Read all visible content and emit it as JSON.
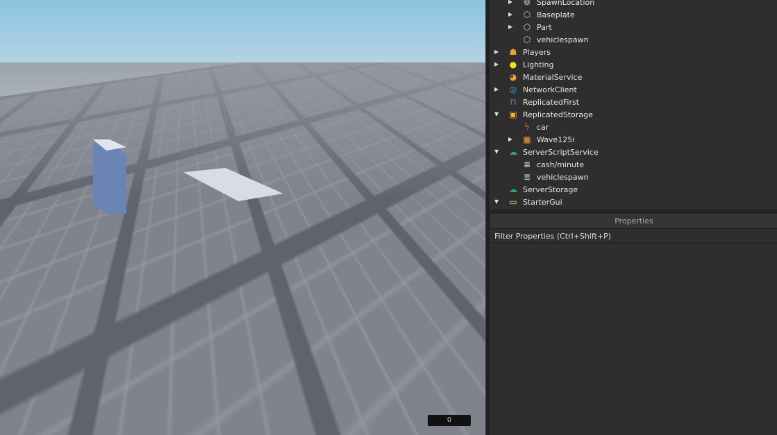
{
  "viewport": {
    "counter": "0"
  },
  "explorer": {
    "items": [
      {
        "label": "SpawnLocation",
        "level": 1,
        "arrow": "right",
        "icon": "spawn-gear-icon",
        "glyph": "⚙",
        "color": "#cfcfcf"
      },
      {
        "label": "Baseplate",
        "level": 1,
        "arrow": "right",
        "icon": "part-cube-icon",
        "glyph": "⬡",
        "color": "#cfcfcf"
      },
      {
        "label": "Part",
        "level": 1,
        "arrow": "right",
        "icon": "part-cube-icon",
        "glyph": "⬡",
        "color": "#cfcfcf"
      },
      {
        "label": "vehiclespawn",
        "level": 1,
        "arrow": "",
        "icon": "part-cube-icon",
        "glyph": "⬡",
        "color": "#cfcfcf"
      },
      {
        "label": "Players",
        "level": 0,
        "arrow": "right",
        "icon": "players-icon",
        "glyph": "☗",
        "color": "#f0a030"
      },
      {
        "label": "Lighting",
        "level": 0,
        "arrow": "right",
        "icon": "lightbulb-icon",
        "glyph": "●",
        "color": "#f5e020"
      },
      {
        "label": "MaterialService",
        "level": 0,
        "arrow": "",
        "icon": "material-service-icon",
        "glyph": "◕",
        "color": "#f0a040"
      },
      {
        "label": "NetworkClient",
        "level": 0,
        "arrow": "right",
        "icon": "network-client-icon",
        "glyph": "◎",
        "color": "#4aa8e8"
      },
      {
        "label": "ReplicatedFirst",
        "level": 0,
        "arrow": "",
        "icon": "replicated-first-icon",
        "glyph": "⊓",
        "color": "#5a8ae8"
      },
      {
        "label": "ReplicatedStorage",
        "level": 0,
        "arrow": "down",
        "icon": "replicated-storage-icon",
        "glyph": "▣",
        "color": "#f0b030"
      },
      {
        "label": "car",
        "level": 1,
        "arrow": "",
        "icon": "script-bolt-icon",
        "glyph": "ϟ",
        "color": "#f06a30"
      },
      {
        "label": "Wave125i",
        "level": 1,
        "arrow": "right",
        "icon": "model-icon",
        "glyph": "▦",
        "color": "#f0a030"
      },
      {
        "label": "ServerScriptService",
        "level": 0,
        "arrow": "down",
        "icon": "server-script-service-icon",
        "glyph": "☁",
        "color": "#20b070"
      },
      {
        "label": "cash/minute",
        "level": 1,
        "arrow": "",
        "icon": "script-icon",
        "glyph": "≣",
        "color": "#dddddd"
      },
      {
        "label": "vehiclespawn",
        "level": 1,
        "arrow": "",
        "icon": "script-icon",
        "glyph": "≣",
        "color": "#dddddd"
      },
      {
        "label": "ServerStorage",
        "level": 0,
        "arrow": "",
        "icon": "server-storage-icon",
        "glyph": "☁",
        "color": "#20b070"
      },
      {
        "label": "StarterGui",
        "level": 0,
        "arrow": "down",
        "icon": "starter-gui-icon",
        "glyph": "▭",
        "color": "#f5d070"
      }
    ]
  },
  "properties": {
    "title": "Properties",
    "filter_placeholder": "Filter Properties (Ctrl+Shift+P)"
  }
}
